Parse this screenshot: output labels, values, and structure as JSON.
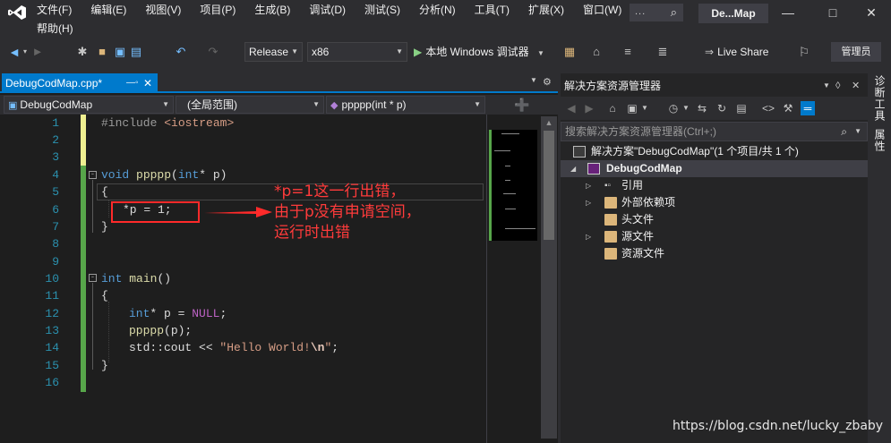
{
  "menu": {
    "row1": [
      "文件(F)",
      "编辑(E)",
      "视图(V)",
      "项目(P)",
      "生成(B)",
      "调试(D)",
      "测试(S)",
      "分析(N)",
      "工具(T)",
      "扩展(X)",
      "窗口(W)"
    ],
    "row2": [
      "帮助(H)"
    ],
    "search_text": "...",
    "window_title": "De...Map"
  },
  "toolbar": {
    "config": "Release",
    "platform": "x86",
    "run_label": "本地 Windows 调试器",
    "live_share": "Live Share",
    "admin": "管理员"
  },
  "editor": {
    "tab_label": "DebugCodMap.cpp*",
    "nav_project": "DebugCodMap",
    "nav_scope": "(全局范围)",
    "nav_function": "ppppp(int * p)",
    "line_numbers": [
      "1",
      "2",
      "3",
      "4",
      "5",
      "6",
      "7",
      "8",
      "9",
      "10",
      "11",
      "12",
      "13",
      "14",
      "15",
      "16"
    ],
    "code": {
      "l1_include": "#include",
      "l1_header": "<iostream>",
      "l4_void": "void",
      "l4_fn": "ppppp",
      "l4_rest": "(",
      "l4_int": "int",
      "l4_tail": "* p)",
      "l5": "{",
      "l6": "*p = 1;",
      "l7": "}",
      "l10_int": "int",
      "l10_fn": "main",
      "l10_tail": "()",
      "l11": "{",
      "l12_int": "int",
      "l12_mid": "* p = ",
      "l12_null": "NULL",
      "l12_end": ";",
      "l13_fn": "ppppp",
      "l13_tail": "(p);",
      "l14_a": "std::cout << ",
      "l14_str": "\"Hello World!",
      "l14_esc": "\\n",
      "l14_strend": "\"",
      "l14_end": ";",
      "l15": "}"
    },
    "annotation": [
      "*p=1这一行出错，",
      "由于p没有申请空间，",
      "运行时出错"
    ]
  },
  "solution_explorer": {
    "title": "解决方案资源管理器",
    "search_placeholder": "搜索解决方案资源管理器(Ctrl+;)",
    "tree": {
      "solution": "解决方案\"DebugCodMap\"(1 个项目/共 1 个)",
      "project": "DebugCodMap",
      "items": [
        "引用",
        "外部依赖项",
        "头文件",
        "源文件",
        "资源文件"
      ]
    }
  },
  "side_tabs": [
    "诊断工具",
    "属性"
  ],
  "watermark": "https://blog.csdn.net/lucky_zbaby",
  "colors": {
    "accent": "#007acc",
    "annotation": "#ff2a2a",
    "background": "#1e1e1e",
    "chrome": "#2d2d30"
  }
}
